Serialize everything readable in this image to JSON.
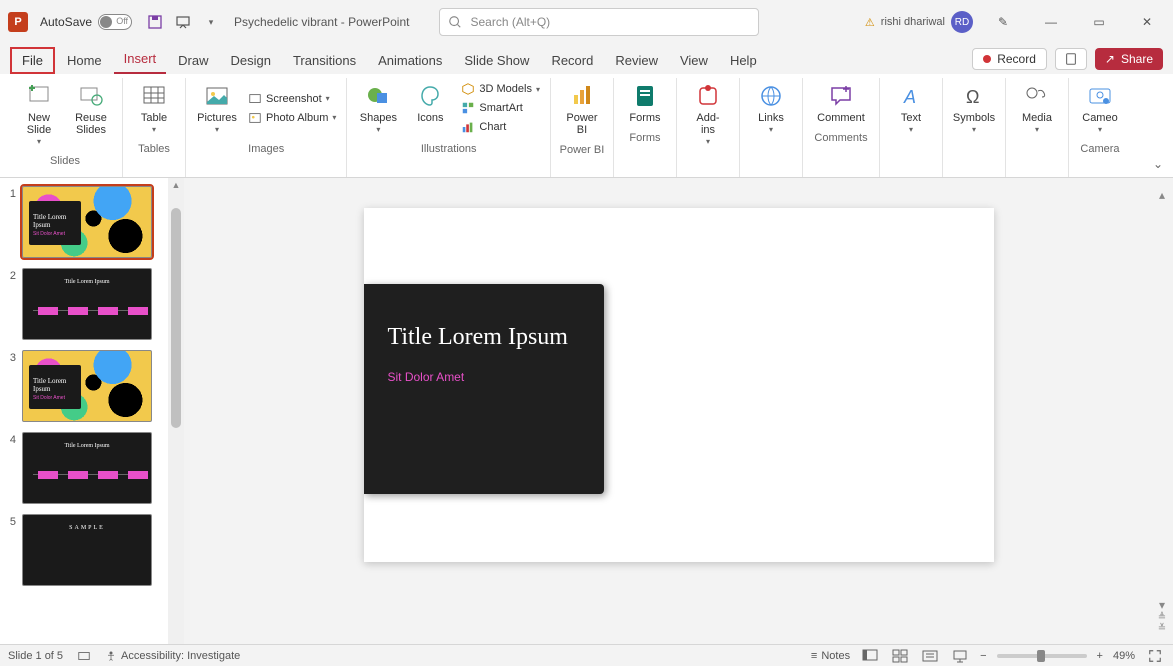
{
  "titlebar": {
    "autosave_label": "AutoSave",
    "autosave_state": "Off",
    "doc_name": "Psychedelic vibrant  -  PowerPoint",
    "search_placeholder": "Search (Alt+Q)",
    "user_name": "rishi dhariwal",
    "user_initials": "RD"
  },
  "tabs": {
    "items": [
      "File",
      "Home",
      "Insert",
      "Draw",
      "Design",
      "Transitions",
      "Animations",
      "Slide Show",
      "Record",
      "Review",
      "View",
      "Help"
    ],
    "active": "Insert",
    "boxed": "File",
    "record_label": "Record",
    "share_label": "Share"
  },
  "ribbon": {
    "slides": {
      "new_slide": "New\nSlide",
      "reuse": "Reuse\nSlides",
      "label": "Slides"
    },
    "tables": {
      "table": "Table",
      "label": "Tables"
    },
    "images": {
      "pictures": "Pictures",
      "screenshot": "Screenshot",
      "photo_album": "Photo Album",
      "label": "Images"
    },
    "illustrations": {
      "shapes": "Shapes",
      "icons": "Icons",
      "models": "3D Models",
      "smartart": "SmartArt",
      "chart": "Chart",
      "label": "Illustrations"
    },
    "powerbi": {
      "btn": "Power\nBI",
      "label": "Power BI"
    },
    "forms": {
      "btn": "Forms",
      "label": "Forms"
    },
    "addins": {
      "btn": "Add-\nins",
      "label": ""
    },
    "links": {
      "btn": "Links",
      "label": ""
    },
    "comments": {
      "btn": "Comment",
      "label": "Comments"
    },
    "text": {
      "btn": "Text",
      "label": ""
    },
    "symbols": {
      "btn": "Symbols",
      "label": ""
    },
    "media": {
      "btn": "Media",
      "label": ""
    },
    "cameo": {
      "btn": "Cameo",
      "label": "Camera"
    }
  },
  "thumbnails": {
    "count": 5,
    "slides": [
      {
        "num": "1",
        "title": "Title Lorem\nIpsum",
        "sub": "Sit Dolor Amet",
        "type": "psych-card",
        "selected": true
      },
      {
        "num": "2",
        "title": "Title Lorem Ipsum",
        "type": "dark-timeline"
      },
      {
        "num": "3",
        "title": "Title Lorem\nIpsum",
        "sub": "Sit Dolor Amet",
        "type": "psych-card"
      },
      {
        "num": "4",
        "title": "Title Lorem Ipsum",
        "type": "dark-timeline"
      },
      {
        "num": "5",
        "title": "SAMPLE",
        "type": "dark-plain"
      }
    ]
  },
  "slide": {
    "title": "Title Lorem Ipsum",
    "subtitle": "Sit Dolor Amet"
  },
  "status": {
    "slide_info": "Slide 1 of 5",
    "accessibility": "Accessibility: Investigate",
    "notes": "Notes",
    "zoom": "49%"
  }
}
